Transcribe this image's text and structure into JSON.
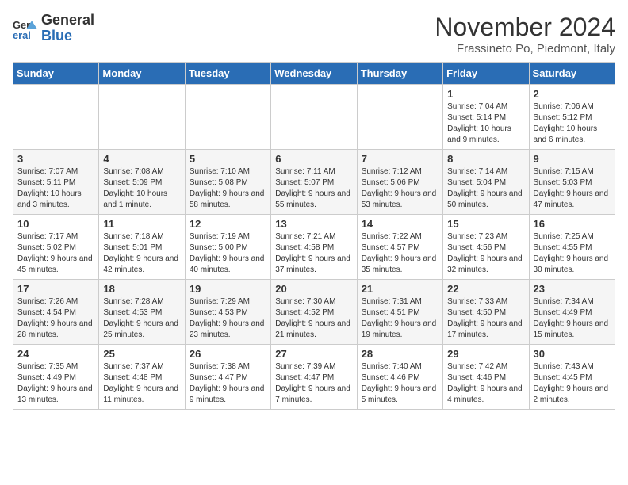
{
  "logo": {
    "general": "General",
    "blue": "Blue"
  },
  "title": "November 2024",
  "location": "Frassineto Po, Piedmont, Italy",
  "days_header": [
    "Sunday",
    "Monday",
    "Tuesday",
    "Wednesday",
    "Thursday",
    "Friday",
    "Saturday"
  ],
  "weeks": [
    [
      {
        "day": "",
        "info": ""
      },
      {
        "day": "",
        "info": ""
      },
      {
        "day": "",
        "info": ""
      },
      {
        "day": "",
        "info": ""
      },
      {
        "day": "",
        "info": ""
      },
      {
        "day": "1",
        "info": "Sunrise: 7:04 AM\nSunset: 5:14 PM\nDaylight: 10 hours and 9 minutes."
      },
      {
        "day": "2",
        "info": "Sunrise: 7:06 AM\nSunset: 5:12 PM\nDaylight: 10 hours and 6 minutes."
      }
    ],
    [
      {
        "day": "3",
        "info": "Sunrise: 7:07 AM\nSunset: 5:11 PM\nDaylight: 10 hours and 3 minutes."
      },
      {
        "day": "4",
        "info": "Sunrise: 7:08 AM\nSunset: 5:09 PM\nDaylight: 10 hours and 1 minute."
      },
      {
        "day": "5",
        "info": "Sunrise: 7:10 AM\nSunset: 5:08 PM\nDaylight: 9 hours and 58 minutes."
      },
      {
        "day": "6",
        "info": "Sunrise: 7:11 AM\nSunset: 5:07 PM\nDaylight: 9 hours and 55 minutes."
      },
      {
        "day": "7",
        "info": "Sunrise: 7:12 AM\nSunset: 5:06 PM\nDaylight: 9 hours and 53 minutes."
      },
      {
        "day": "8",
        "info": "Sunrise: 7:14 AM\nSunset: 5:04 PM\nDaylight: 9 hours and 50 minutes."
      },
      {
        "day": "9",
        "info": "Sunrise: 7:15 AM\nSunset: 5:03 PM\nDaylight: 9 hours and 47 minutes."
      }
    ],
    [
      {
        "day": "10",
        "info": "Sunrise: 7:17 AM\nSunset: 5:02 PM\nDaylight: 9 hours and 45 minutes."
      },
      {
        "day": "11",
        "info": "Sunrise: 7:18 AM\nSunset: 5:01 PM\nDaylight: 9 hours and 42 minutes."
      },
      {
        "day": "12",
        "info": "Sunrise: 7:19 AM\nSunset: 5:00 PM\nDaylight: 9 hours and 40 minutes."
      },
      {
        "day": "13",
        "info": "Sunrise: 7:21 AM\nSunset: 4:58 PM\nDaylight: 9 hours and 37 minutes."
      },
      {
        "day": "14",
        "info": "Sunrise: 7:22 AM\nSunset: 4:57 PM\nDaylight: 9 hours and 35 minutes."
      },
      {
        "day": "15",
        "info": "Sunrise: 7:23 AM\nSunset: 4:56 PM\nDaylight: 9 hours and 32 minutes."
      },
      {
        "day": "16",
        "info": "Sunrise: 7:25 AM\nSunset: 4:55 PM\nDaylight: 9 hours and 30 minutes."
      }
    ],
    [
      {
        "day": "17",
        "info": "Sunrise: 7:26 AM\nSunset: 4:54 PM\nDaylight: 9 hours and 28 minutes."
      },
      {
        "day": "18",
        "info": "Sunrise: 7:28 AM\nSunset: 4:53 PM\nDaylight: 9 hours and 25 minutes."
      },
      {
        "day": "19",
        "info": "Sunrise: 7:29 AM\nSunset: 4:53 PM\nDaylight: 9 hours and 23 minutes."
      },
      {
        "day": "20",
        "info": "Sunrise: 7:30 AM\nSunset: 4:52 PM\nDaylight: 9 hours and 21 minutes."
      },
      {
        "day": "21",
        "info": "Sunrise: 7:31 AM\nSunset: 4:51 PM\nDaylight: 9 hours and 19 minutes."
      },
      {
        "day": "22",
        "info": "Sunrise: 7:33 AM\nSunset: 4:50 PM\nDaylight: 9 hours and 17 minutes."
      },
      {
        "day": "23",
        "info": "Sunrise: 7:34 AM\nSunset: 4:49 PM\nDaylight: 9 hours and 15 minutes."
      }
    ],
    [
      {
        "day": "24",
        "info": "Sunrise: 7:35 AM\nSunset: 4:49 PM\nDaylight: 9 hours and 13 minutes."
      },
      {
        "day": "25",
        "info": "Sunrise: 7:37 AM\nSunset: 4:48 PM\nDaylight: 9 hours and 11 minutes."
      },
      {
        "day": "26",
        "info": "Sunrise: 7:38 AM\nSunset: 4:47 PM\nDaylight: 9 hours and 9 minutes."
      },
      {
        "day": "27",
        "info": "Sunrise: 7:39 AM\nSunset: 4:47 PM\nDaylight: 9 hours and 7 minutes."
      },
      {
        "day": "28",
        "info": "Sunrise: 7:40 AM\nSunset: 4:46 PM\nDaylight: 9 hours and 5 minutes."
      },
      {
        "day": "29",
        "info": "Sunrise: 7:42 AM\nSunset: 4:46 PM\nDaylight: 9 hours and 4 minutes."
      },
      {
        "day": "30",
        "info": "Sunrise: 7:43 AM\nSunset: 4:45 PM\nDaylight: 9 hours and 2 minutes."
      }
    ]
  ]
}
